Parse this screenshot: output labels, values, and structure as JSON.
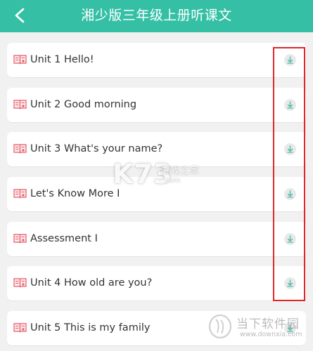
{
  "header": {
    "title": "湘少版三年级上册听课文",
    "back_icon": "back-arrow-icon"
  },
  "lessons": [
    {
      "label": "Unit 1 Hello!"
    },
    {
      "label": "Unit 2 Good morning"
    },
    {
      "label": "Unit 3 What's your name?"
    },
    {
      "label": "Let's Know More I"
    },
    {
      "label": "Assessment I"
    },
    {
      "label": "Unit 4 How old are you?"
    },
    {
      "label": "Unit 5 This is my family"
    }
  ],
  "icons": {
    "lesson_icon": "book-icon",
    "download_icon": "download-icon"
  },
  "colors": {
    "header_bg": "#35c0a6",
    "page_bg": "#f1f1f1",
    "highlight": "#e0262a",
    "download_arrow": "#4fb7a6",
    "book_icon": "#e35a68"
  },
  "watermarks": {
    "k73_logo": "K73",
    "k73_name": "游戏之家",
    "k73_url": ".com",
    "downxia_name": "当下软件园",
    "downxia_url": "www.downxia.com"
  }
}
